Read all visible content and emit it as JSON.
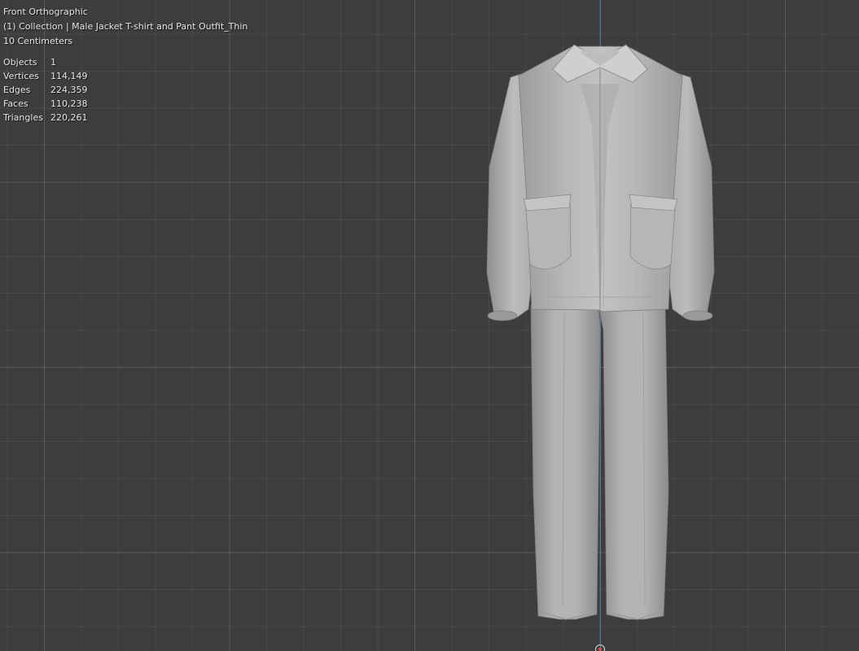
{
  "viewport": {
    "view_name": "Front Orthographic",
    "collection_line": "(1) Collection | Male Jacket T-shirt and Pant Outfit_Thin",
    "grid_scale": "10 Centimeters"
  },
  "stats": [
    {
      "label": "Objects",
      "value": "1"
    },
    {
      "label": "Vertices",
      "value": "114,149"
    },
    {
      "label": "Edges",
      "value": "224,359"
    },
    {
      "label": "Faces",
      "value": "110,238"
    },
    {
      "label": "Triangles",
      "value": "220,261"
    }
  ],
  "colors": {
    "background": "#3d3d3d",
    "z_axis": "#4b79b8",
    "mesh": "#b4b4b4"
  },
  "model_icon": "jacket-and-pants-mesh"
}
